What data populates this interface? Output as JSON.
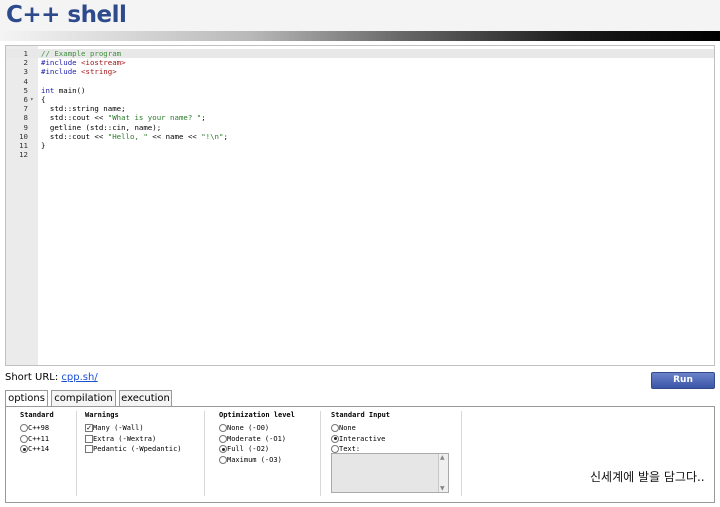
{
  "app": {
    "title": "C++ shell"
  },
  "editor": {
    "lines": [
      {
        "num": "1",
        "fold": "",
        "active": true,
        "tokens": [
          {
            "cls": "cm",
            "text": "// Example program"
          }
        ]
      },
      {
        "num": "2",
        "fold": "",
        "tokens": [
          {
            "cls": "pp",
            "text": "#include "
          },
          {
            "cls": "hdr",
            "text": "<iostream>"
          }
        ]
      },
      {
        "num": "3",
        "fold": "",
        "tokens": [
          {
            "cls": "pp",
            "text": "#include "
          },
          {
            "cls": "hdr",
            "text": "<string>"
          }
        ]
      },
      {
        "num": "4",
        "fold": "",
        "tokens": []
      },
      {
        "num": "5",
        "fold": "",
        "tokens": [
          {
            "cls": "kw",
            "text": "int"
          },
          {
            "cls": "tx",
            "text": " main()"
          }
        ]
      },
      {
        "num": "6",
        "fold": "▾",
        "tokens": [
          {
            "cls": "tx",
            "text": "{"
          }
        ]
      },
      {
        "num": "7",
        "fold": "",
        "tokens": [
          {
            "cls": "tx",
            "text": "  std::string name;"
          }
        ]
      },
      {
        "num": "8",
        "fold": "",
        "tokens": [
          {
            "cls": "tx",
            "text": "  std::cout << "
          },
          {
            "cls": "st",
            "text": "\"What is your name? \""
          },
          {
            "cls": "tx",
            "text": ";"
          }
        ]
      },
      {
        "num": "9",
        "fold": "",
        "tokens": [
          {
            "cls": "tx",
            "text": "  getline (std::cin, name);"
          }
        ]
      },
      {
        "num": "10",
        "fold": "",
        "tokens": [
          {
            "cls": "tx",
            "text": "  std::cout << "
          },
          {
            "cls": "st",
            "text": "\"Hello, \""
          },
          {
            "cls": "tx",
            "text": " << name << "
          },
          {
            "cls": "st",
            "text": "\"!\\n\""
          },
          {
            "cls": "tx",
            "text": ";"
          }
        ]
      },
      {
        "num": "11",
        "fold": "",
        "tokens": [
          {
            "cls": "tx",
            "text": "}"
          }
        ]
      },
      {
        "num": "12",
        "fold": "",
        "tokens": []
      }
    ]
  },
  "short_url": {
    "label": "Short URL:",
    "link": "cpp.sh/"
  },
  "run_button": {
    "label": "Run"
  },
  "tabs": [
    {
      "label": "options",
      "active": true
    },
    {
      "label": "compilation",
      "active": false
    },
    {
      "label": "execution",
      "active": false
    }
  ],
  "options": {
    "standard": {
      "title": "Standard",
      "items": [
        {
          "label": "C++98",
          "checked": false
        },
        {
          "label": "C++11",
          "checked": false
        },
        {
          "label": "C++14",
          "checked": true
        }
      ]
    },
    "warnings": {
      "title": "Warnings",
      "items": [
        {
          "label": "Many (-Wall)",
          "checked": true
        },
        {
          "label": "Extra (-Wextra)",
          "checked": false
        },
        {
          "label": "Pedantic (-Wpedantic)",
          "checked": false
        }
      ]
    },
    "optimization": {
      "title": "Optimization level",
      "items": [
        {
          "label": "None (-O0)",
          "checked": false
        },
        {
          "label": "Moderate (-O1)",
          "checked": false
        },
        {
          "label": "Full (-O2)",
          "checked": true
        },
        {
          "label": "Maximum (-O3)",
          "checked": false
        }
      ]
    },
    "stdin": {
      "title": "Standard Input",
      "items": [
        {
          "label": "None",
          "checked": false
        },
        {
          "label": "Interactive",
          "checked": true
        },
        {
          "label": "Text:",
          "checked": false
        }
      ],
      "text_value": ""
    }
  },
  "watermark": {
    "text": "신세계에 발을 담그다.."
  }
}
